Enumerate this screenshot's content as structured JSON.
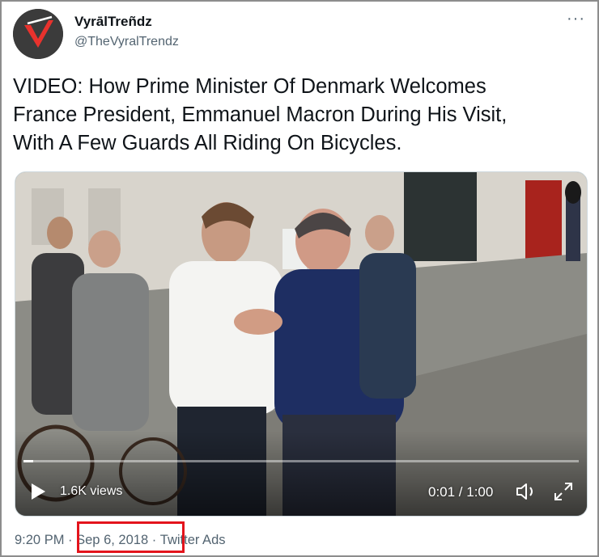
{
  "header": {
    "display_name": "VyrālTreñdz",
    "handle": "@TheVyralTrendz",
    "more_label": "···"
  },
  "tweet": {
    "text_lines": [
      "VIDEO: How Prime Minister Of Denmark Welcomes",
      "France President, Emmanuel Macron During His Visit,",
      "With A Few Guards All Riding On Bicycles."
    ]
  },
  "video": {
    "views_label": "1.6K views",
    "time_label": "0:01 / 1:00",
    "progress_fraction": 0.017
  },
  "footer": {
    "time": "9:20 PM",
    "separator1": " · ",
    "date": "Sep 6, 2018",
    "separator2": " · ",
    "source": "Twitter Ads"
  },
  "colors": {
    "highlight": "#e3141c",
    "avatar_accent": "#e8322d"
  },
  "icons": {
    "avatar": "vyral-logo-icon",
    "play": "play-icon",
    "volume": "volume-icon",
    "fullscreen": "fullscreen-icon",
    "more": "more-icon"
  }
}
